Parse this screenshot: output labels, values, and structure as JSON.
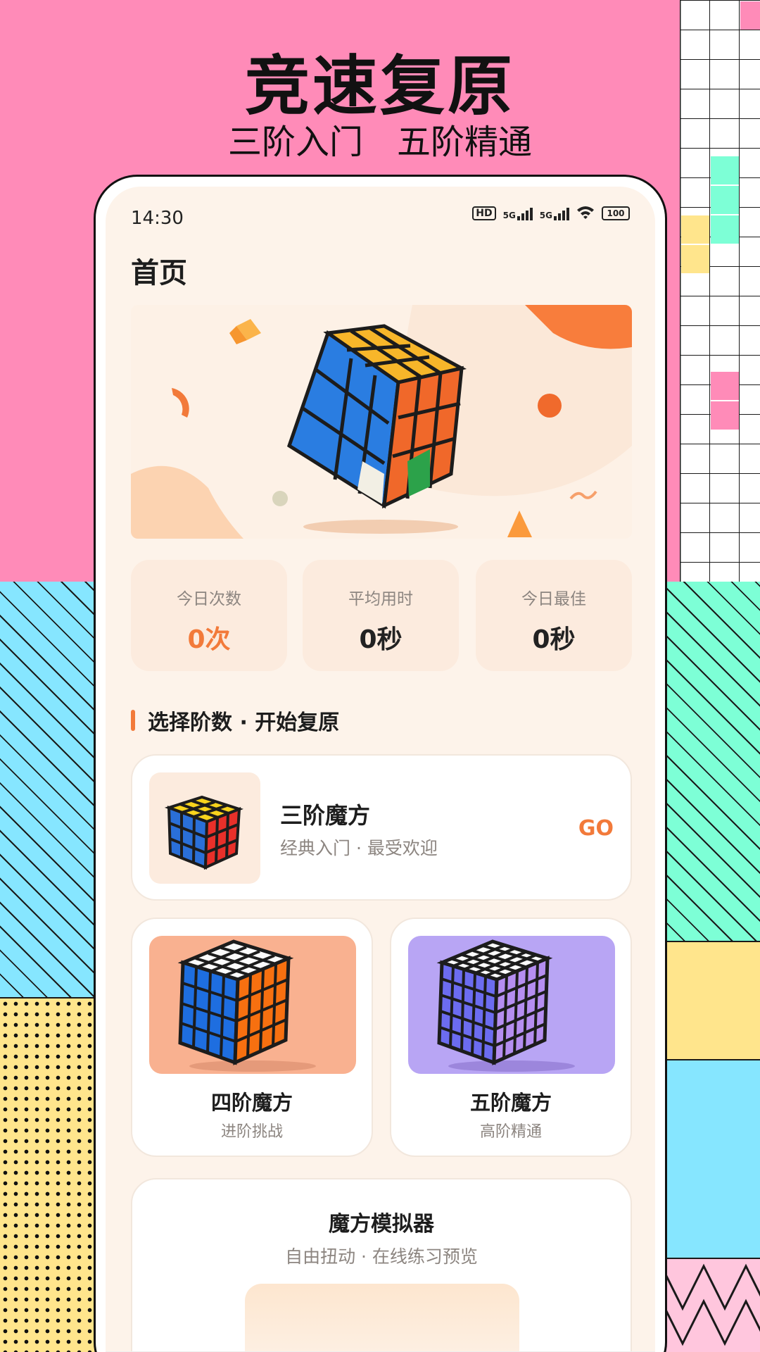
{
  "promo": {
    "title": "竞速复原",
    "subtitle": "三阶入门　五阶精通"
  },
  "status_bar": {
    "time": "14:30",
    "hd_label": "HD",
    "net1": "5G",
    "net2": "5G",
    "battery": "100"
  },
  "page": {
    "title": "首页"
  },
  "stats": [
    {
      "label": "今日次数",
      "value": "0次"
    },
    {
      "label": "平均用时",
      "value": "0秒"
    },
    {
      "label": "今日最佳",
      "value": "0秒"
    }
  ],
  "section_title": "选择阶数 · 开始复原",
  "cube3": {
    "title": "三阶魔方",
    "subtitle": "经典入门 · 最受欢迎",
    "go": "GO"
  },
  "cube4": {
    "title": "四阶魔方",
    "subtitle": "进阶挑战"
  },
  "cube5": {
    "title": "五阶魔方",
    "subtitle": "高阶精通"
  },
  "simulator": {
    "title": "魔方模拟器",
    "subtitle": "自由扭动 · 在线练习预览"
  },
  "colors": {
    "accent": "#f27a3a",
    "background_pink": "#ff8bb8",
    "screen_bg": "#fdf3ea"
  }
}
